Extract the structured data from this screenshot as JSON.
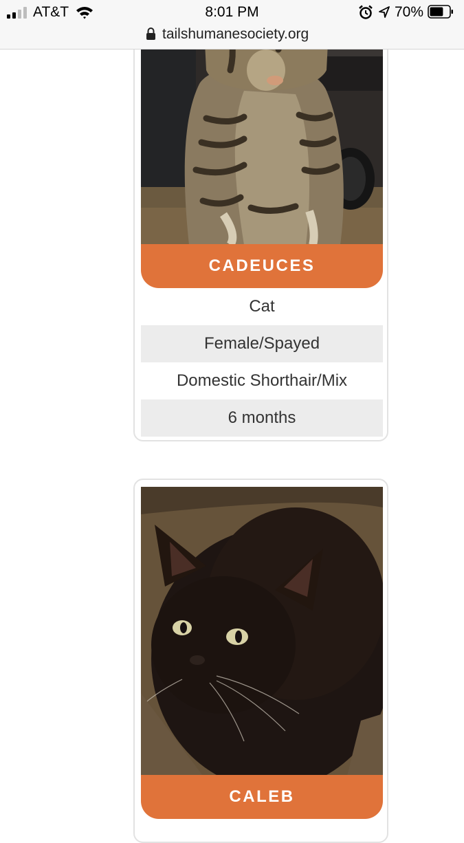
{
  "status_bar": {
    "carrier": "AT&T",
    "time": "8:01 PM",
    "battery_percent": "70%",
    "battery_level": 0.7,
    "icons": [
      "signal-icon",
      "wifi-icon",
      "alarm-icon",
      "location-icon",
      "battery-icon"
    ]
  },
  "url_bar": {
    "url": "tailshumanesociety.org",
    "icon": "lock-icon"
  },
  "colors": {
    "accent": "#e0733a",
    "row_shade": "#ececec",
    "card_border": "#e2e2e2"
  },
  "pets": [
    {
      "name": "CADEUCES",
      "photo": "tabby-kitten-photo",
      "details": [
        "Cat",
        "Female/Spayed",
        "Domestic Shorthair/Mix",
        "6 months"
      ]
    },
    {
      "name": "CALEB",
      "photo": "black-cat-photo",
      "details": []
    }
  ]
}
